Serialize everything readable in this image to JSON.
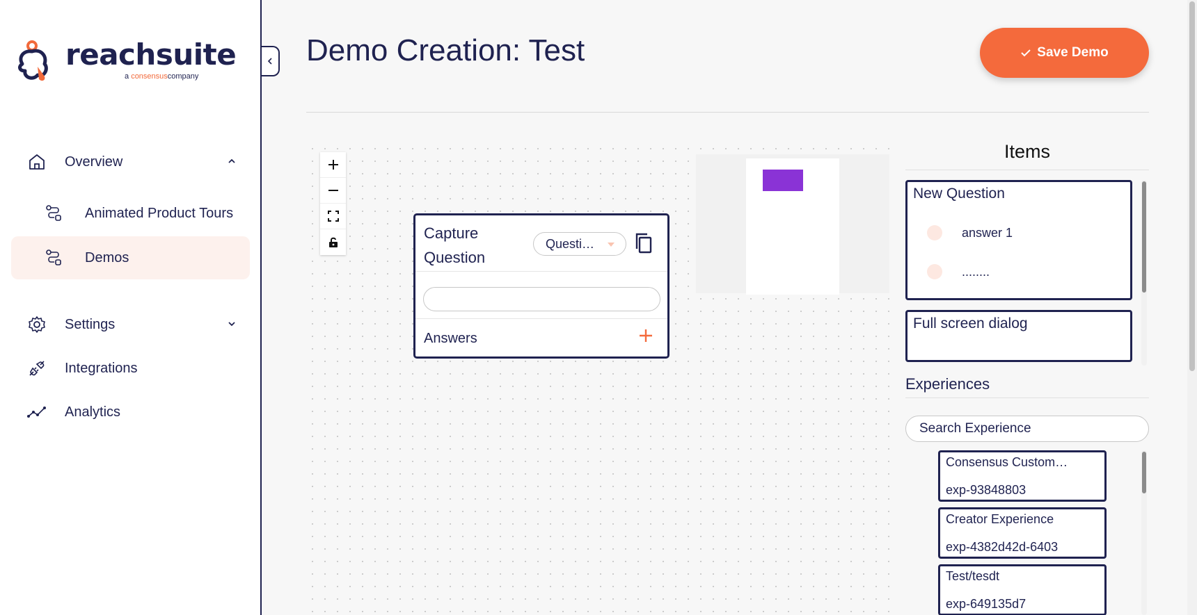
{
  "brand": {
    "name": "reachsuite",
    "tagline_prefix": "a",
    "tagline_accent": "consensus",
    "tagline_suffix": "company",
    "accent_color": "#f26a3b",
    "primary_color": "#1f2250"
  },
  "sidebar": {
    "items": [
      {
        "label": "Overview",
        "icon": "home-icon",
        "chevron": "up"
      },
      {
        "label": "Animated Product Tours",
        "icon": "route-icon"
      },
      {
        "label": "Demos",
        "icon": "route-icon",
        "active": true
      },
      {
        "label": "Settings",
        "icon": "gear-icon",
        "chevron": "down"
      },
      {
        "label": "Integrations",
        "icon": "plug-icon"
      },
      {
        "label": "Analytics",
        "icon": "analytics-icon"
      }
    ]
  },
  "header": {
    "title": "Demo Creation: Test",
    "save_label": "Save Demo"
  },
  "canvas": {
    "node": {
      "title": "Capture Question",
      "type_select": "Questi…",
      "input_value": "",
      "answers_label": "Answers"
    }
  },
  "items_panel": {
    "title": "Items",
    "cards": [
      {
        "title": "New Question",
        "answers": [
          "answer 1",
          "........"
        ]
      },
      {
        "title": "Full screen dialog"
      }
    ]
  },
  "experiences": {
    "title": "Experiences",
    "search_placeholder": "Search Experience",
    "list": [
      {
        "name": "Consensus Custom…",
        "id": "exp-93848803"
      },
      {
        "name": "Creator Experience",
        "id": "exp-4382d42d-6403"
      },
      {
        "name": "Test/tesdt",
        "id": "exp-649135d7"
      }
    ]
  }
}
